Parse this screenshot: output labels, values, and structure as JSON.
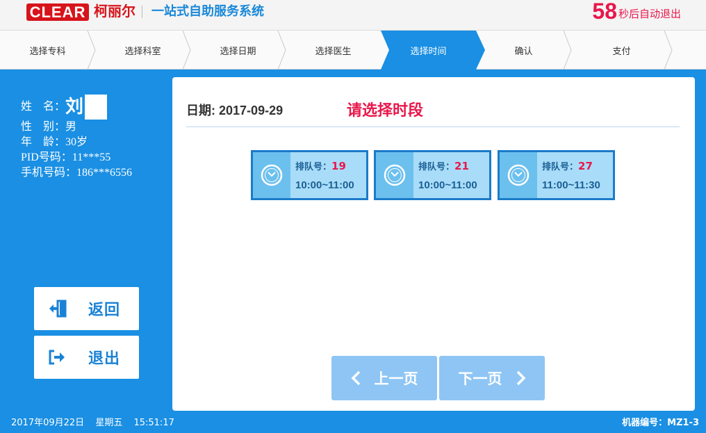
{
  "header": {
    "logo_text": "CLEAR",
    "logo_cn": "柯丽尔",
    "system_title": "一站式自助服务系统",
    "countdown_number": "58",
    "countdown_text": "秒后自动退出"
  },
  "steps": [
    {
      "label": "选择专科",
      "active": false
    },
    {
      "label": "选择科室",
      "active": false
    },
    {
      "label": "选择日期",
      "active": false
    },
    {
      "label": "选择医生",
      "active": false
    },
    {
      "label": "选择时间",
      "active": true
    },
    {
      "label": "确认",
      "active": false
    },
    {
      "label": "支付",
      "active": false
    }
  ],
  "patient": {
    "name_label": "姓　名：",
    "name_value": "刘",
    "gender_label": "性　别：",
    "gender_value": "男",
    "age_label": "年　龄：",
    "age_value": "30岁",
    "pid_label": "PID号码：",
    "pid_value": "11***55",
    "phone_label": "手机号码：",
    "phone_value": "186***6556"
  },
  "side_buttons": {
    "back_label": "返回",
    "exit_label": "退出"
  },
  "main": {
    "date_label": "日期:",
    "date_value": "2017-09-29",
    "prompt": "请选择时段",
    "slots": [
      {
        "queue_label": "排队号：",
        "queue_no": "19",
        "time": "10:00~11:00"
      },
      {
        "queue_label": "排队号：",
        "queue_no": "21",
        "time": "10:00~11:00"
      },
      {
        "queue_label": "排队号：",
        "queue_no": "27",
        "time": "11:00~11:30"
      }
    ],
    "prev_label": "上一页",
    "next_label": "下一页"
  },
  "footer": {
    "date": "2017年09月22日",
    "weekday": "星期五",
    "time": "15:51:17",
    "machine": "机器编号：MZ1-3"
  },
  "colors": {
    "brand_red": "#d7141b",
    "accent_blue": "#1a8fe3",
    "highlight_pink": "#e8174b"
  }
}
